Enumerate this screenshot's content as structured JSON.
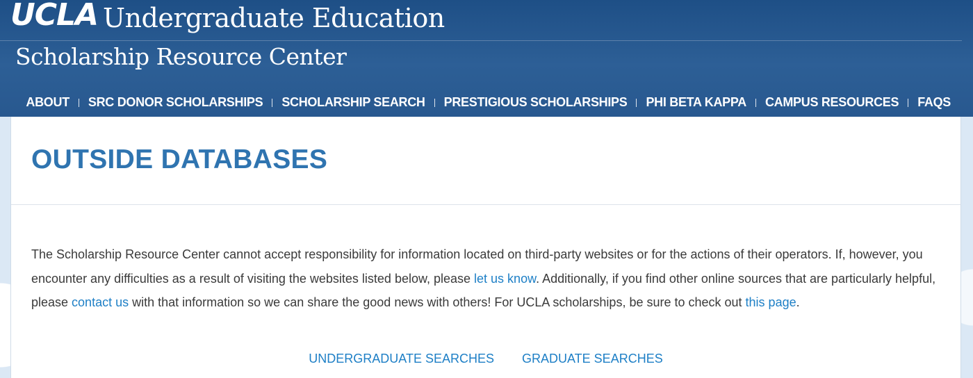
{
  "header": {
    "logo": "UCLA",
    "title": "Undergraduate Education",
    "subtitle": "Scholarship Resource Center"
  },
  "nav": {
    "items": [
      {
        "label": "ABOUT"
      },
      {
        "label": "SRC DONOR SCHOLARSHIPS"
      },
      {
        "label": "SCHOLARSHIP SEARCH"
      },
      {
        "label": "PRESTIGIOUS SCHOLARSHIPS"
      },
      {
        "label": "PHI BETA KAPPA"
      },
      {
        "label": "CAMPUS RESOURCES"
      },
      {
        "label": "FAQS"
      }
    ]
  },
  "main": {
    "title": "OUTSIDE DATABASES",
    "paragraph": {
      "part1": "The Scholarship Resource Center cannot accept responsibility for information located on third-party websites or for the actions of their operators. If, however, you encounter any difficulties as a result of visiting the websites listed below, please ",
      "link1": "let us know",
      "part2": ". Additionally, if you find other online sources that are particularly helpful, please ",
      "link2": "contact us",
      "part3": " with that information so we can share the good news with others! For UCLA scholarships, be sure to check out ",
      "link3": "this page",
      "part4": "."
    },
    "search_links": {
      "undergraduate": "UNDERGRADUATE SEARCHES",
      "graduate": "GRADUATE SEARCHES"
    }
  },
  "colors": {
    "header_blue": "#2d5f96",
    "title_blue": "#2f74b0",
    "link_blue": "#1d7fc6",
    "body_text": "#3a3a3a"
  }
}
